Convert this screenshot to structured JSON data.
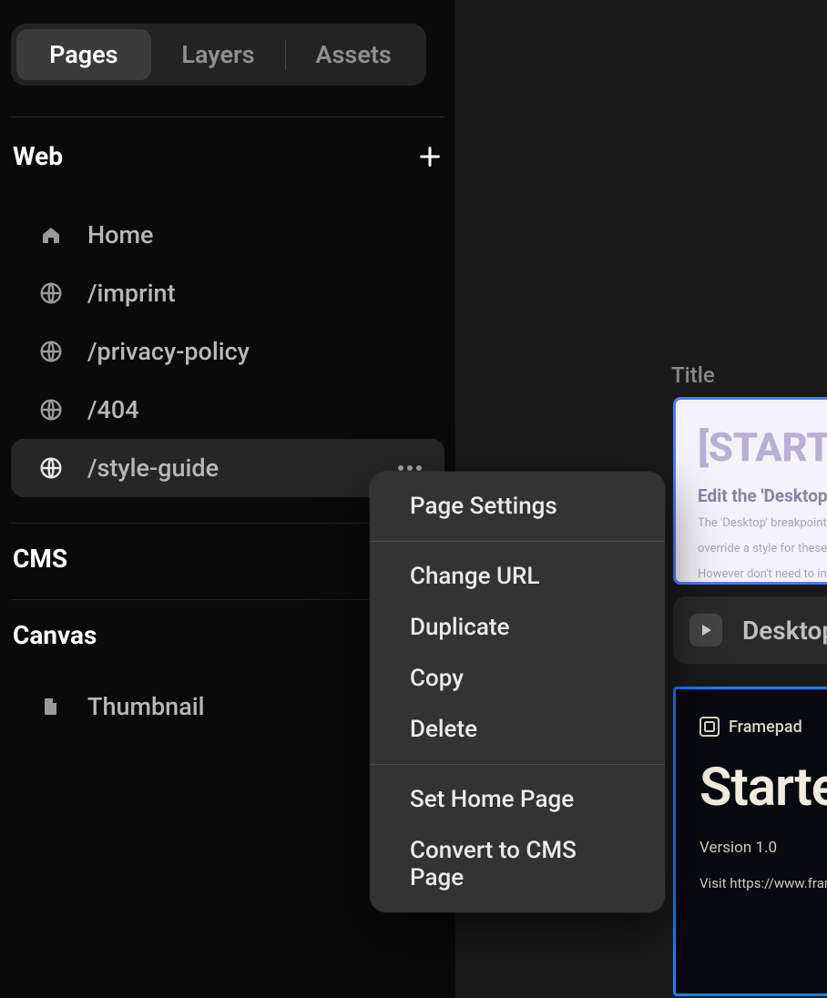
{
  "tabs": {
    "pages": "Pages",
    "layers": "Layers",
    "assets": "Assets"
  },
  "sections": {
    "web": "Web",
    "cms": "CMS",
    "canvas": "Canvas"
  },
  "pages": [
    {
      "label": "Home"
    },
    {
      "label": "/imprint"
    },
    {
      "label": "/privacy-policy"
    },
    {
      "label": "/404"
    },
    {
      "label": "/style-guide"
    }
  ],
  "canvas_items": [
    {
      "label": "Thumbnail"
    }
  ],
  "context_menu": {
    "page_settings": "Page Settings",
    "change_url": "Change URL",
    "duplicate": "Duplicate",
    "copy": "Copy",
    "delete": "Delete",
    "set_home": "Set Home Page",
    "convert_cms": "Convert to CMS Page"
  },
  "canvas_area": {
    "title_label": "Title",
    "preview": {
      "heading": "[START H",
      "subheading": "Edit the 'Desktop' b",
      "body1": "The 'Desktop' breakpoint is where",
      "body2": "override a style for these smaller",
      "body3": "However don't need to interact w"
    },
    "chip": {
      "label": "Desktop"
    },
    "darkcard": {
      "brand": "Framepad",
      "heading": "Starter",
      "version": "Version 1.0",
      "visit": "Visit https://www.framepad.co/st"
    }
  }
}
